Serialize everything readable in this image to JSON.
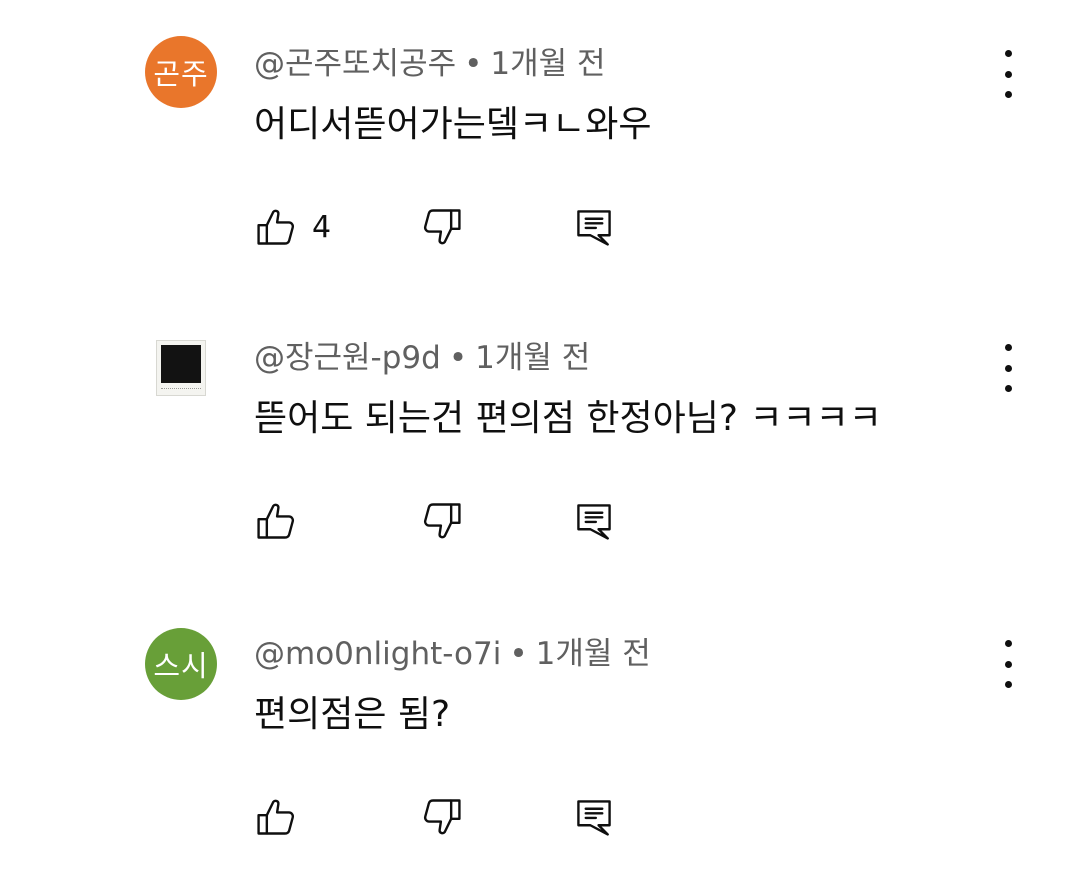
{
  "comments": [
    {
      "avatar_text": "곤주",
      "avatar_color": "#e9762b",
      "author": "@곤주또치공주",
      "separator": "•",
      "time": "1개월 전",
      "text": "어디서뜯어가는뎈ㅋㄴ와우",
      "likes": "4"
    },
    {
      "avatar_text": "",
      "avatar_color": "#121212",
      "author": "@장근원-p9d",
      "separator": "•",
      "time": "1개월 전",
      "text": "뜯어도 되는건 편의점 한정아님? ㅋㅋㅋㅋ",
      "likes": ""
    },
    {
      "avatar_text": "스시",
      "avatar_color": "#689f38",
      "author": "@mo0nlight-o7i",
      "separator": "•",
      "time": "1개월 전",
      "text": "편의점은 됨?",
      "likes": ""
    }
  ],
  "icons": {
    "like": "thumbs-up-icon",
    "dislike": "thumbs-down-icon",
    "reply": "reply-icon",
    "more": "more-vert-icon"
  }
}
